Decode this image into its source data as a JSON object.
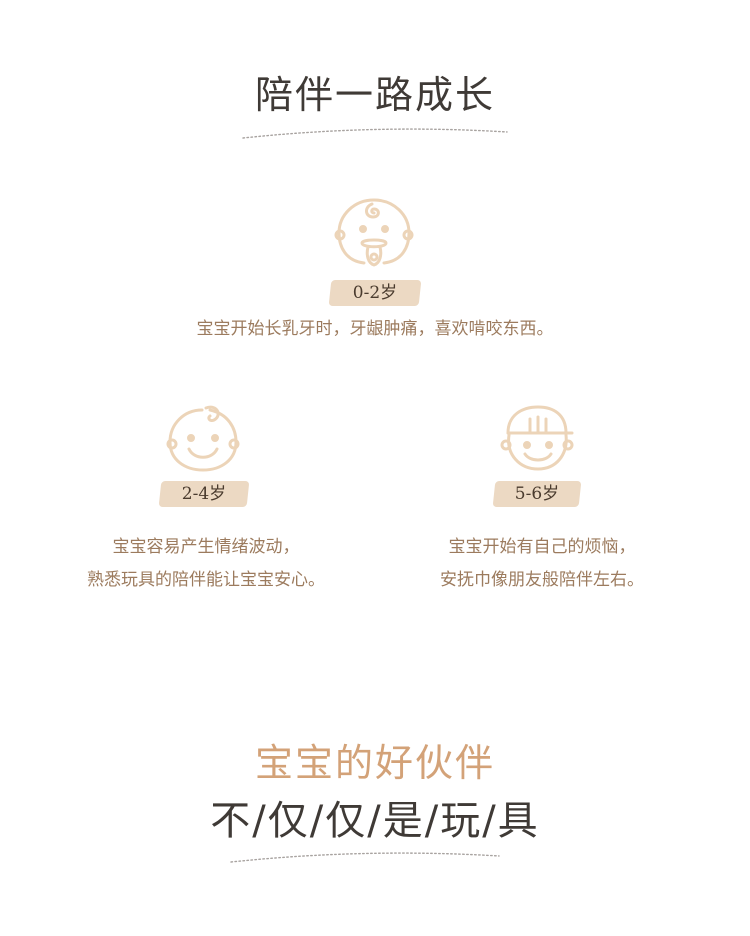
{
  "header": {
    "title": "陪伴一路成长"
  },
  "stages": [
    {
      "icon": "baby-pacifier-icon",
      "age": "0-2岁",
      "lines": [
        "宝宝开始长乳牙时，牙龈肿痛，喜欢啃咬东西。"
      ]
    },
    {
      "icon": "toddler-smile-icon",
      "age": "2-4岁",
      "lines": [
        "宝宝容易产生情绪波动，",
        "熟悉玩具的陪伴能让宝宝安心。"
      ]
    },
    {
      "icon": "child-cap-icon",
      "age": "5-6岁",
      "lines": [
        "宝宝开始有自己的烦恼，",
        "安抚巾像朋友般陪伴左右。"
      ]
    }
  ],
  "footer": {
    "tagline": "宝宝的好伙伴",
    "slogan": "不/仅/仅/是/玩/具"
  },
  "colors": {
    "title": "#3f3a36",
    "accent": "#d3a278",
    "icon_stroke": "#ecd4b8",
    "badge_bg": "#ecd9c3",
    "desc_text": "#9c7b5e"
  }
}
